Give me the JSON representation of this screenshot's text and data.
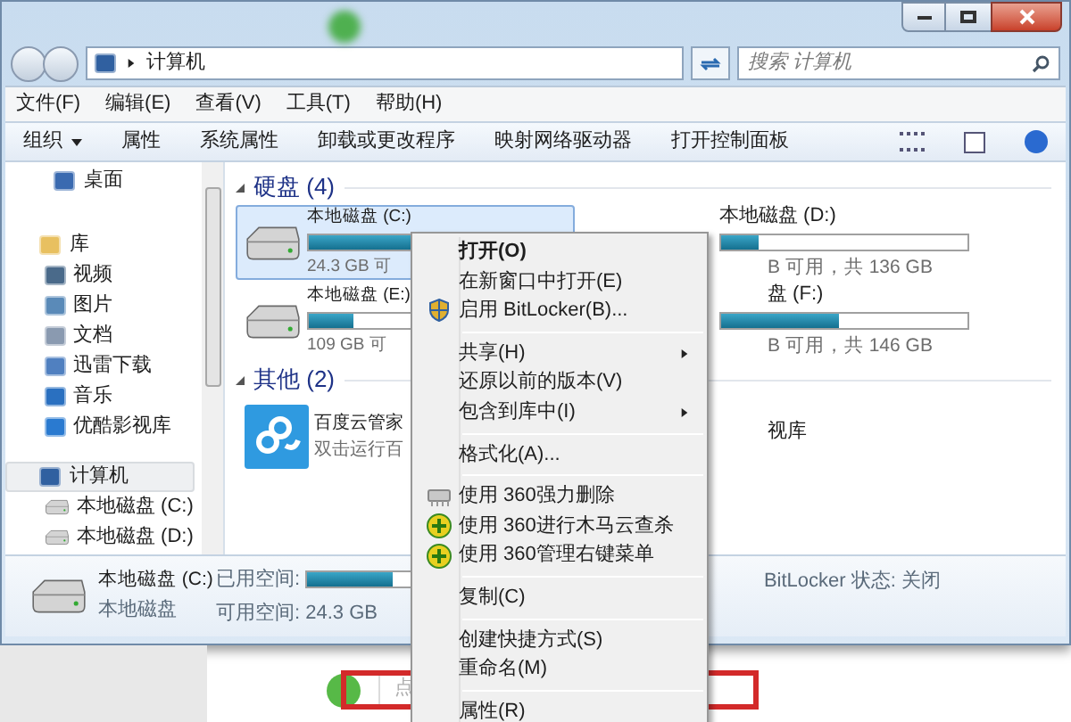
{
  "address_bar": {
    "path": "计算机",
    "search_placeholder": "搜索 计算机"
  },
  "menu_bar": [
    "文件(F)",
    "编辑(E)",
    "查看(V)",
    "工具(T)",
    "帮助(H)"
  ],
  "toolbar": [
    {
      "label": "组织",
      "dropdown": true
    },
    {
      "label": "属性",
      "dropdown": false
    },
    {
      "label": "系统属性",
      "dropdown": false
    },
    {
      "label": "卸载或更改程序",
      "dropdown": false
    },
    {
      "label": "映射网络驱动器",
      "dropdown": false
    },
    {
      "label": "打开控制面板",
      "dropdown": false
    }
  ],
  "sidebar": {
    "items": [
      {
        "label": "桌面",
        "selected": false
      },
      {
        "label": "库",
        "selected": false,
        "children": [
          {
            "label": "视频",
            "selected": false
          },
          {
            "label": "图片",
            "selected": false
          },
          {
            "label": "文档",
            "selected": false
          },
          {
            "label": "迅雷下载",
            "selected": false
          },
          {
            "label": "音乐",
            "selected": false
          },
          {
            "label": "优酷影视库",
            "selected": false
          }
        ]
      },
      {
        "label": "计算机",
        "selected": true,
        "children": [
          {
            "label": "本地磁盘 (C:)",
            "selected": false
          },
          {
            "label": "本地磁盘 (D:)",
            "selected": false
          }
        ]
      }
    ]
  },
  "groups": [
    {
      "title": "硬盘 (4)",
      "items": [
        {
          "kind": "drive",
          "name": "本地磁盘 (C:)",
          "free": "24.3 GB 可",
          "level": 0.85,
          "selected": true
        },
        {
          "kind": "drive",
          "name": "本地磁盘 (D:)",
          "free": "B 可用，共 136 GB",
          "level": 0.15,
          "selected": false
        },
        {
          "kind": "drive",
          "name": "本地磁盘 (E:)",
          "free": "109 GB 可",
          "level": 0.2,
          "selected": false
        },
        {
          "kind": "drive",
          "name": "盘 (F:)",
          "free": "B 可用，共 146 GB",
          "level": 0.48,
          "selected": false
        }
      ]
    },
    {
      "title": "其他 (2)",
      "items": [
        {
          "kind": "app",
          "name": "百度云管家",
          "free": "双击运行百",
          "selected": false
        },
        {
          "kind": "app",
          "name": "视库",
          "selected": false
        }
      ]
    }
  ],
  "details": {
    "name": "本地磁盘 (C:)",
    "type": "本地磁盘",
    "used_label": "已用空间:",
    "level": 0.8,
    "free_label": "可用空间: 24.3 GB",
    "bitlocker": "BitLocker 状态: 关闭"
  },
  "context_menu": [
    {
      "kind": "item",
      "label": "打开(O)",
      "default": true,
      "submenu": false
    },
    {
      "kind": "item",
      "label": "在新窗口中打开(E)",
      "default": false,
      "submenu": false
    },
    {
      "kind": "item",
      "label": "启用 BitLocker(B)...",
      "default": false,
      "submenu": false
    },
    {
      "kind": "separator"
    },
    {
      "kind": "item",
      "label": "共享(H)",
      "default": false,
      "submenu": true
    },
    {
      "kind": "item",
      "label": "还原以前的版本(V)",
      "default": false,
      "submenu": false
    },
    {
      "kind": "item",
      "label": "包含到库中(I)",
      "default": false,
      "submenu": true
    },
    {
      "kind": "separator"
    },
    {
      "kind": "item",
      "label": "格式化(A)...",
      "default": false,
      "submenu": false
    },
    {
      "kind": "separator"
    },
    {
      "kind": "item",
      "label": "使用 360强力删除",
      "default": false,
      "submenu": false
    },
    {
      "kind": "item",
      "label": "使用 360进行木马云查杀",
      "default": false,
      "submenu": false
    },
    {
      "kind": "item",
      "label": "使用 360管理右键菜单",
      "default": false,
      "submenu": false
    },
    {
      "kind": "separator"
    },
    {
      "kind": "item",
      "label": "复制(C)",
      "default": false,
      "submenu": false
    },
    {
      "kind": "separator"
    },
    {
      "kind": "item",
      "label": "创建快捷方式(S)",
      "default": false,
      "submenu": false
    },
    {
      "kind": "item",
      "label": "重命名(M)",
      "default": false,
      "submenu": false
    },
    {
      "kind": "separator"
    },
    {
      "kind": "item",
      "label": "属性(R)",
      "default": false,
      "submenu": false
    }
  ],
  "page_behind": {
    "field_placeholder": "点"
  }
}
